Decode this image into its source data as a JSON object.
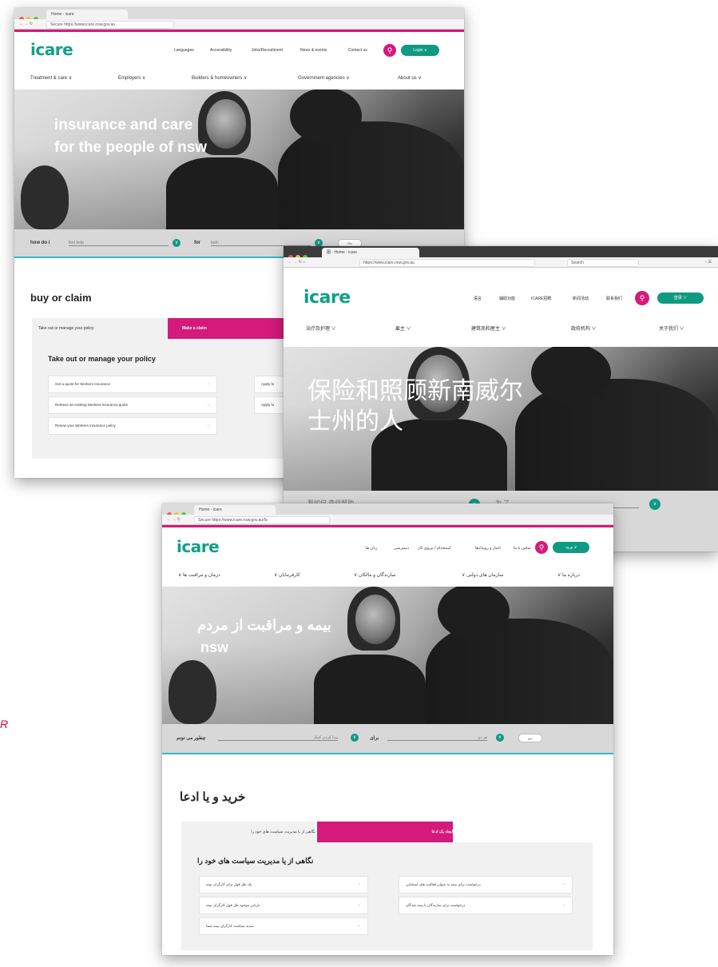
{
  "stray_letter": "R",
  "en": {
    "tab_title": "Home - icare",
    "url": "Secure https://www.icare.nsw.gov.au",
    "logo": "icare",
    "utility": [
      "Languages",
      "Accessibility",
      "Jobs/Recruitment",
      "News & events",
      "Contact us"
    ],
    "login": "Login  ∨",
    "nav": [
      "Treatment & care  ∨",
      "Employers  ∨",
      "Builders & homeowners  ∨",
      "Government agencies  ∨",
      "About us  ∨"
    ],
    "hero_line1": "insurance and care",
    "hero_line2": "for the people of nsw",
    "how_do_i": "how do i",
    "how_value": "find help",
    "for": "for",
    "for_value": "both",
    "go": "Go",
    "section": "buy or claim",
    "tab_manage": "Take out or manage your policy",
    "tab_claim": "Make a claim",
    "panel_title": "Take out or manage your policy",
    "cards": [
      "Get a quote for Workers Insurance",
      "Retrieve an existing Workers Insurance quote",
      "Renew your Workers Insurance policy"
    ],
    "cards_right": [
      "Apply fo",
      "Apply fo"
    ]
  },
  "zh": {
    "tab_title": "图 - Home - icare",
    "url": "https://www.icare.nsw.gov.au",
    "search_placeholder": "Search",
    "logo": "icare",
    "utility": [
      "语言",
      "辅助功能",
      "ICARE招聘",
      "新闻活动",
      "联系我们"
    ],
    "login": "登录  ∨",
    "nav": [
      "治疗及护理  ∨",
      "雇主  ∨",
      "建筑商和屋主  ∨",
      "政府机构  ∨",
      "关于我们  ∨"
    ],
    "hero_line1": "保险和照顾新南威尔",
    "hero_line2": "士州的人",
    "search_label1": "我如何 查找帮助",
    "search_label2": "为 了"
  },
  "fa": {
    "tab_title": "Home - icare",
    "url": "Secure https://www.icare.nsw.gov.au/fa",
    "logo": "icare",
    "utility": [
      "زبان ها",
      "دسترسی",
      "استخدام / نیروی کار",
      "اخبار و رویدادها",
      "تماس با ما"
    ],
    "login": "ورود  ∨",
    "nav": [
      "درمان و مراقبت ها  ∨",
      "کارفرمایان  ∨",
      "سازندگان و مالکان  ∨",
      "سازمان های دولتی  ∨",
      "درباره ما  ∨"
    ],
    "hero_line1": "بیمه و مراقبت از مردم",
    "hero_line2": "nsw",
    "how_do_i": "چطور می تونم",
    "how_value": "پیدا کردن کمک",
    "for": "برای",
    "for_value": "هر دو",
    "go": "برو",
    "section": "خرید و یا ادعا",
    "tab_manage": "نگاهی از یا مدیریت سیاست های خود را",
    "tab_claim": "ایجاد یک ادعا",
    "panel_title": "نگاهی از یا مدیریت سیاست های خود را",
    "cards_left": [
      "یک نقل قول برای کارگران بیمه",
      "بازیابی موجود نقل قول کارگران بیمه",
      "تمدید سیاست کارگران بیمه شما"
    ],
    "cards_right": [
      "درخواست برای بیمه به عنوان فعالیت های استثنایی",
      "درخواست برای سازندگان یا بیمه شدگان"
    ]
  }
}
